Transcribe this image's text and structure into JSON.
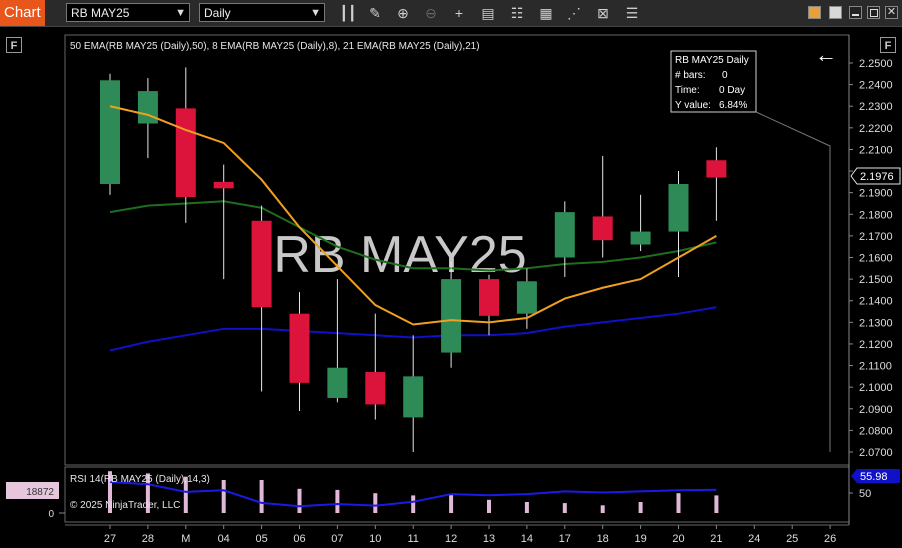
{
  "toolbar": {
    "chart_tab": "Chart",
    "instrument": "RB MAY25",
    "period": "Daily",
    "tools": [
      "bar-style-icon",
      "draw-icon",
      "zoom-in-icon",
      "zoom-out-icon",
      "crosshair-icon",
      "data-box-icon",
      "properties-icon",
      "chart-trader-icon",
      "strategy-icon",
      "indicators-icon",
      "templates-icon"
    ]
  },
  "panel_buttons": {
    "top_left": "F",
    "top_right": "F"
  },
  "watermark": "RB MAY25",
  "indicator_label": "50 EMA(RB MAY25 (Daily),50), 8 EMA(RB MAY25 (Daily),8), 21 EMA(RB MAY25 (Daily),21)",
  "databox": {
    "title": "RB MAY25 Daily",
    "rows": [
      {
        "label": "# bars:",
        "value": "0"
      },
      {
        "label": "Time:",
        "value": "0 Day"
      },
      {
        "label": "Y value:",
        "value": "6.84%"
      }
    ]
  },
  "price_axis": {
    "ticks": [
      "2.2500",
      "2.2400",
      "2.2300",
      "2.2200",
      "2.2100",
      "2.2000",
      "2.1900",
      "2.1800",
      "2.1700",
      "2.1600",
      "2.1500",
      "2.1400",
      "2.1300",
      "2.1200",
      "2.1100",
      "2.1000",
      "2.0900",
      "2.0800",
      "2.0700"
    ],
    "current_price": "2.1976"
  },
  "rsi": {
    "label": "RSI 14(RB MAY25 (Daily),14,3)",
    "copyright": "© 2025 NinjaTrader, LLC",
    "axis_ticks": [
      "50"
    ],
    "current_value": "55.98",
    "volume_label": "18872",
    "volume_zero": "0"
  },
  "x_axis": [
    "27",
    "28",
    "M",
    "04",
    "05",
    "06",
    "07",
    "10",
    "11",
    "12",
    "13",
    "14",
    "17",
    "18",
    "19",
    "20",
    "21",
    "24",
    "25",
    "26"
  ],
  "colors": {
    "up": "#2e8b57",
    "down": "#dc143c",
    "ema8": "#f0a020",
    "ema21": "#1e6e1e",
    "ema50": "#1010c8",
    "rsi": "#1a1ae6",
    "volume": "#e0b8d8",
    "accent": "#e8561c"
  },
  "chart_data": {
    "type": "candlestick",
    "ylim": [
      2.065,
      2.255
    ],
    "x": [
      "27",
      "28",
      "M",
      "04",
      "05",
      "06",
      "07",
      "10",
      "11",
      "12",
      "13",
      "14",
      "17",
      "18",
      "19",
      "20",
      "21"
    ],
    "candles": [
      {
        "o": 2.194,
        "h": 2.245,
        "l": 2.189,
        "c": 2.242
      },
      {
        "o": 2.222,
        "h": 2.243,
        "l": 2.206,
        "c": 2.237
      },
      {
        "o": 2.229,
        "h": 2.248,
        "l": 2.176,
        "c": 2.188
      },
      {
        "o": 2.195,
        "h": 2.203,
        "l": 2.15,
        "c": 2.192
      },
      {
        "o": 2.177,
        "h": 2.184,
        "l": 2.098,
        "c": 2.137
      },
      {
        "o": 2.134,
        "h": 2.144,
        "l": 2.089,
        "c": 2.102
      },
      {
        "o": 2.095,
        "h": 2.15,
        "l": 2.093,
        "c": 2.109
      },
      {
        "o": 2.107,
        "h": 2.134,
        "l": 2.085,
        "c": 2.092
      },
      {
        "o": 2.086,
        "h": 2.124,
        "l": 2.07,
        "c": 2.105
      },
      {
        "o": 2.116,
        "h": 2.158,
        "l": 2.109,
        "c": 2.15
      },
      {
        "o": 2.15,
        "h": 2.152,
        "l": 2.124,
        "c": 2.133
      },
      {
        "o": 2.134,
        "h": 2.155,
        "l": 2.127,
        "c": 2.149
      },
      {
        "o": 2.16,
        "h": 2.186,
        "l": 2.151,
        "c": 2.181
      },
      {
        "o": 2.179,
        "h": 2.207,
        "l": 2.16,
        "c": 2.168
      },
      {
        "o": 2.166,
        "h": 2.189,
        "l": 2.163,
        "c": 2.172
      },
      {
        "o": 2.172,
        "h": 2.2,
        "l": 2.151,
        "c": 2.194
      },
      {
        "o": 2.205,
        "h": 2.211,
        "l": 2.177,
        "c": 2.197
      }
    ],
    "ema8": [
      2.23,
      2.226,
      2.219,
      2.213,
      2.196,
      2.174,
      2.156,
      2.138,
      2.129,
      2.131,
      2.13,
      2.132,
      2.141,
      2.146,
      2.15,
      2.16,
      2.17
    ],
    "ema21": [
      2.181,
      2.184,
      2.185,
      2.186,
      2.183,
      2.174,
      2.165,
      2.159,
      2.155,
      2.155,
      2.154,
      2.155,
      2.157,
      2.158,
      2.16,
      2.163,
      2.167
    ],
    "ema50": [
      2.117,
      2.121,
      2.124,
      2.127,
      2.127,
      2.126,
      2.125,
      2.124,
      2.123,
      2.124,
      2.124,
      2.125,
      2.128,
      2.13,
      2.132,
      2.134,
      2.137
    ],
    "rsi_values": [
      70,
      66,
      52,
      55,
      32,
      26,
      30,
      27,
      34,
      48,
      46,
      48,
      53,
      51,
      53,
      55,
      56
    ],
    "volume": [
      38,
      36,
      33,
      30,
      30,
      22,
      21,
      18,
      16,
      17,
      12,
      10,
      9,
      7,
      10,
      18,
      16
    ]
  }
}
